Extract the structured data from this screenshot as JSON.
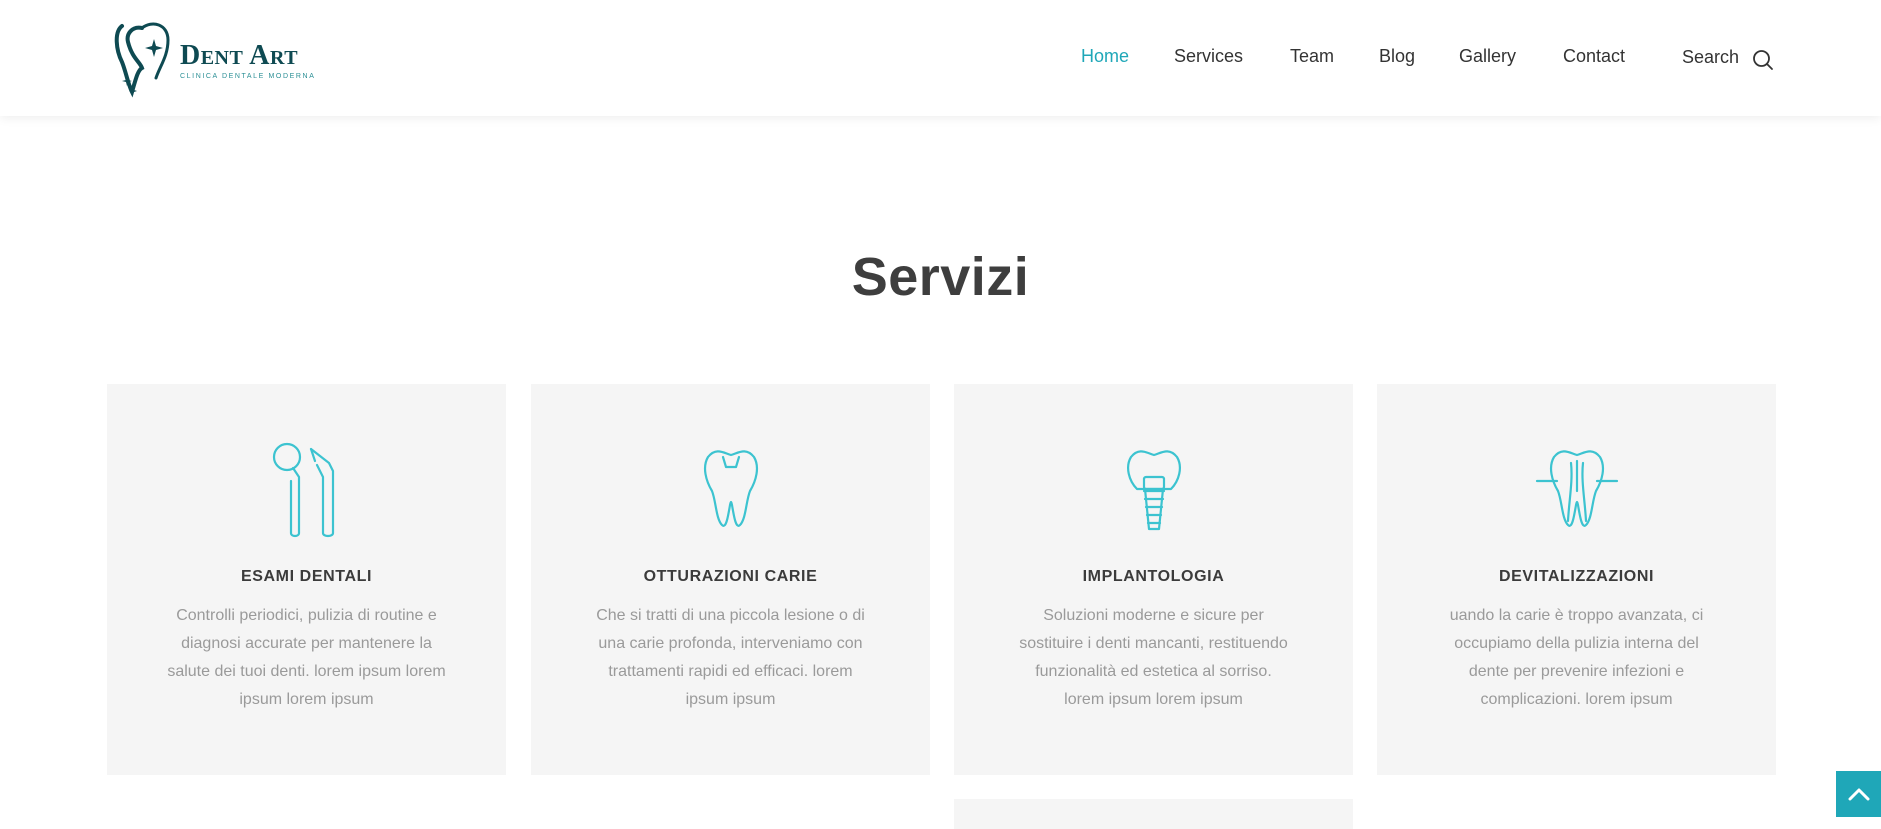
{
  "brand": {
    "name": "Dent Art",
    "tagline": "Clinica Dentale Moderna"
  },
  "nav": {
    "items": [
      {
        "label": "Home",
        "active": true
      },
      {
        "label": "Services",
        "active": false
      },
      {
        "label": "Team",
        "active": false
      },
      {
        "label": "Blog",
        "active": false
      },
      {
        "label": "Gallery",
        "active": false
      },
      {
        "label": "Contact",
        "active": false
      }
    ],
    "search_label": "Search"
  },
  "services": {
    "title": "Servizi",
    "cards": [
      {
        "icon": "dental-tools-icon",
        "title": "ESAMI DENTALI",
        "text": "Controlli periodici, pulizia di routine e diagnosi accurate per mantenere la salute dei tuoi denti. lorem ipsum lorem ipsum lorem ipsum"
      },
      {
        "icon": "tooth-filling-icon",
        "title": "OTTURAZIONI CARIE",
        "text": "Che si tratti di una piccola lesione o di una carie profonda, interveniamo con trattamenti rapidi ed efficaci. lorem ipsum ipsum"
      },
      {
        "icon": "dental-implant-icon",
        "title": "IMPLANTOLOGIA",
        "text": "Soluzioni moderne e sicure per sostituire i denti mancanti, restituendo funzionalità ed estetica al sorriso. lorem ipsum lorem ipsum"
      },
      {
        "icon": "tooth-root-canal-icon",
        "title": "DEVITALIZZAZIONI",
        "text": "uando la carie è troppo avanzata, ci occupiamo della pulizia interna del dente per prevenire infezioni e complicazioni. lorem ipsum"
      }
    ]
  },
  "colors": {
    "accent": "#1fa7b8",
    "icon": "#3cc3d0",
    "card_bg": "#f5f5f5",
    "heading": "#3e3e3e",
    "body_text": "#9a9a9a",
    "logo": "#0e4a52"
  },
  "back_to_top_icon": "chevron-up-icon"
}
